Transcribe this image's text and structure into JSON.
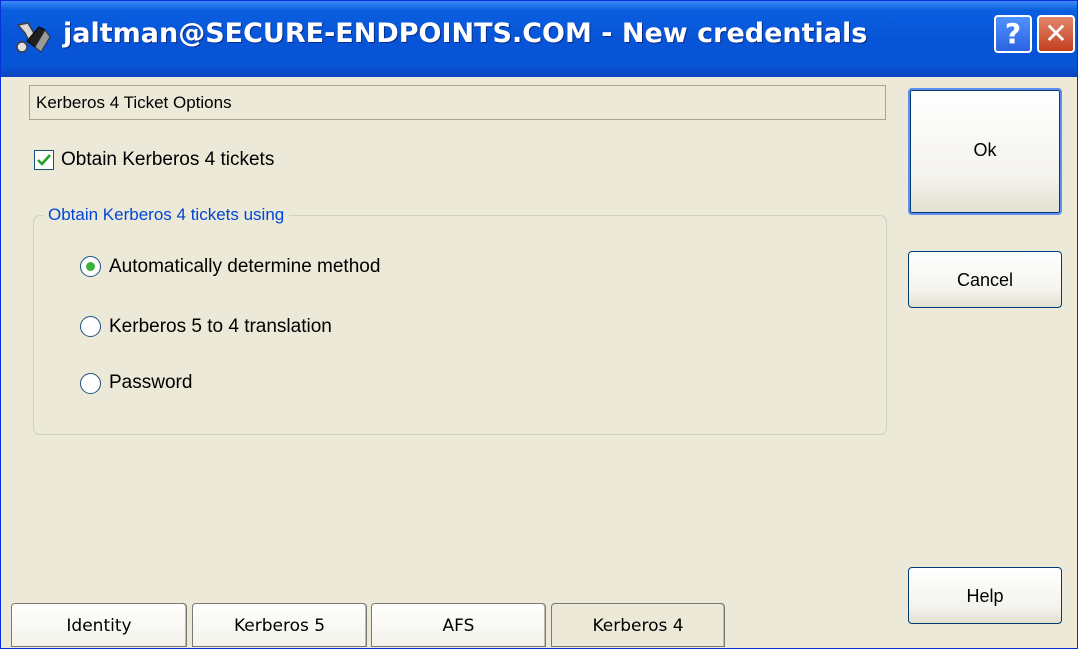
{
  "window": {
    "title": "jaltman@SECURE-ENDPOINTS.COM - New credentials",
    "help_glyph": "?",
    "close_glyph": "✕"
  },
  "panel": {
    "header": "Kerberos 4 Ticket Options",
    "obtain_checkbox": {
      "label": "Obtain Kerberos 4 tickets",
      "checked": true
    },
    "group": {
      "legend": "Obtain Kerberos 4 tickets using",
      "options": [
        {
          "label": "Automatically determine method",
          "selected": true
        },
        {
          "label": "Kerberos 5 to 4 translation",
          "selected": false
        },
        {
          "label": "Password",
          "selected": false
        }
      ]
    }
  },
  "buttons": {
    "ok": "Ok",
    "cancel": "Cancel",
    "help": "Help"
  },
  "tabs": [
    {
      "label": "Identity",
      "active": false
    },
    {
      "label": "Kerberos 5",
      "active": false
    },
    {
      "label": "AFS",
      "active": false
    },
    {
      "label": "Kerberos 4",
      "active": true
    }
  ],
  "colors": {
    "titlebar": "#0754d7",
    "dialog_bg": "#ece9d8",
    "legend_text": "#0046d5",
    "check_green": "#3cb03c"
  },
  "icons": {
    "app": "keys-icon",
    "help": "help-icon",
    "close": "close-icon",
    "check": "checkmark-icon"
  }
}
